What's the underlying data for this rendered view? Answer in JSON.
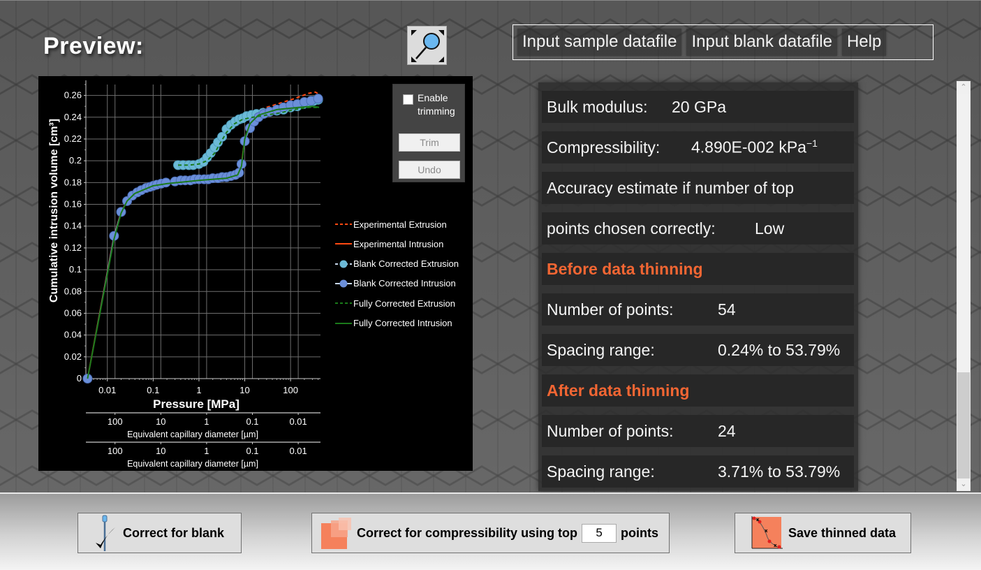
{
  "header": {
    "title": "Preview:",
    "zoom_button_icon": "zoom-magnifier-icon"
  },
  "menu": {
    "items": [
      {
        "label": "Input sample datafile"
      },
      {
        "label": "Input blank datafile"
      },
      {
        "label": "Help"
      }
    ]
  },
  "trim_panel": {
    "checkbox_label": "Enable trimming",
    "checked": false,
    "trim_label": "Trim",
    "undo_label": "Undo"
  },
  "results": {
    "bulk_modulus_label": "Bulk modulus:",
    "bulk_modulus_value": "20 GPa",
    "compressibility_label": "Compressibility:",
    "compressibility_value": "4.890E-002 kPa",
    "compressibility_unit_exp": "−1",
    "accuracy_line1": "Accuracy estimate if number of top",
    "accuracy_line2_label": "points chosen correctly:",
    "accuracy_value": "Low",
    "before_heading": "Before data thinning",
    "before_points_label": "Number of points:",
    "before_points_value": "54",
    "before_spacing_label": "Spacing range:",
    "before_spacing_value": "0.24% to 53.79%",
    "after_heading": "After data thinning",
    "after_points_label": "Number of points:",
    "after_points_value": "24",
    "after_spacing_label": "Spacing range:",
    "after_spacing_value": "3.71% to 53.79%"
  },
  "actions": {
    "correct_blank_label": "Correct for blank",
    "correct_compress_label": "Correct for compressibility using top",
    "top_points_value": "5",
    "points_suffix": "points",
    "save_label": "Save thinned data"
  },
  "colors": {
    "accent_orange": "#f26633",
    "exp_line": "#ff4a12",
    "blank_extrusion": "#6cb9d6",
    "blank_intrusion": "#6b8fd9",
    "fully_corrected": "#1a7a1a"
  },
  "chart_data": {
    "type": "scatter",
    "xlabel": "Pressure [MPa]",
    "ylabel": "Cumulative intrusion volume [cm³]",
    "xscale": "log",
    "xlim": [
      0.0034,
      450
    ],
    "ylim": [
      0,
      0.27
    ],
    "x_ticks": [
      "0.01",
      "0.1",
      "1",
      "10",
      "100"
    ],
    "x_tick_values": [
      0.01,
      0.1,
      1,
      10,
      100
    ],
    "y_ticks": [
      "0",
      "0.02",
      "0.04",
      "0.06",
      "0.08",
      "0.1",
      "0.12",
      "0.14",
      "0.16",
      "0.18",
      "0.2",
      "0.22",
      "0.24",
      "0.26"
    ],
    "y_tick_values": [
      0,
      0.02,
      0.04,
      0.06,
      0.08,
      0.1,
      0.12,
      0.14,
      0.16,
      0.18,
      0.2,
      0.22,
      0.24,
      0.26
    ],
    "grid": true,
    "legend_position": "right",
    "secondary_axes": [
      {
        "label": "Equivalent capillary diameter [µm]",
        "ticks": [
          "100",
          "10",
          "1",
          "0.1",
          "0.01"
        ],
        "tick_pressure": [
          0.0147,
          0.147,
          1.47,
          14.7,
          147
        ]
      },
      {
        "label": "Equivalent capillary diameter [µm]",
        "ticks": [
          "100",
          "10",
          "1",
          "0.1",
          "0.01"
        ],
        "tick_pressure": [
          0.0147,
          0.147,
          1.47,
          14.7,
          147
        ]
      }
    ],
    "series": [
      {
        "name": "Experimental Extrusion",
        "style": "dashed",
        "color": "#ff4a12",
        "x": [
          0.35,
          0.6,
          1.0,
          1.5,
          2.2,
          3.0,
          4.0,
          6.0,
          9.0,
          15,
          30,
          60,
          120,
          250,
          350,
          420
        ],
        "y": [
          0.196,
          0.196,
          0.197,
          0.2,
          0.208,
          0.218,
          0.228,
          0.236,
          0.241,
          0.245,
          0.249,
          0.253,
          0.257,
          0.262,
          0.263,
          0.261
        ]
      },
      {
        "name": "Experimental Intrusion",
        "style": "solid",
        "color": "#ff4a12",
        "x": [
          0.0037,
          0.014,
          0.02,
          0.027,
          0.04,
          0.1,
          0.2,
          1,
          4,
          7,
          8.5,
          10,
          13,
          20,
          50,
          150,
          420
        ],
        "y": [
          0.0,
          0.131,
          0.153,
          0.163,
          0.17,
          0.177,
          0.18,
          0.183,
          0.185,
          0.189,
          0.197,
          0.22,
          0.232,
          0.24,
          0.246,
          0.25,
          0.257
        ]
      },
      {
        "name": "Blank Corrected Extrusion",
        "style": "dashed-marker",
        "color": "#6cb9d6",
        "x": [
          0.35,
          0.45,
          0.6,
          0.75,
          1.0,
          1.25,
          1.5,
          1.8,
          2.2,
          2.6,
          3.2,
          4.0,
          5.0,
          6.2,
          7.5,
          9.0,
          11,
          14,
          18,
          25,
          35,
          50,
          70,
          100,
          140,
          190,
          250,
          320,
          400
        ],
        "y": [
          0.196,
          0.196,
          0.196,
          0.196,
          0.197,
          0.199,
          0.203,
          0.207,
          0.212,
          0.217,
          0.222,
          0.229,
          0.233,
          0.236,
          0.238,
          0.239,
          0.241,
          0.242,
          0.243,
          0.244,
          0.245,
          0.246,
          0.247,
          0.249,
          0.25,
          0.252,
          0.253,
          0.255,
          0.256
        ]
      },
      {
        "name": "Blank Corrected Intrusion",
        "style": "solid-marker",
        "color": "#6b8fd9",
        "x": [
          0.0037,
          0.014,
          0.02,
          0.027,
          0.035,
          0.045,
          0.055,
          0.07,
          0.085,
          0.1,
          0.12,
          0.15,
          0.19,
          0.3,
          0.4,
          0.5,
          0.65,
          0.8,
          1.0,
          1.3,
          1.6,
          2.0,
          2.6,
          3.2,
          4.0,
          5.0,
          6.2,
          7.5,
          8.5,
          10,
          13,
          16,
          20,
          26,
          35,
          50,
          70,
          100,
          140,
          200,
          280,
          400
        ],
        "y": [
          0.0,
          0.131,
          0.153,
          0.163,
          0.168,
          0.171,
          0.173,
          0.175,
          0.176,
          0.177,
          0.178,
          0.179,
          0.18,
          0.181,
          0.182,
          0.182,
          0.182,
          0.183,
          0.183,
          0.183,
          0.183,
          0.184,
          0.184,
          0.185,
          0.185,
          0.186,
          0.187,
          0.189,
          0.197,
          0.218,
          0.23,
          0.236,
          0.24,
          0.243,
          0.245,
          0.247,
          0.249,
          0.251,
          0.252,
          0.254,
          0.255,
          0.257
        ]
      },
      {
        "name": "Fully Corrected Extrusion",
        "style": "dashed",
        "color": "#1a7a1a",
        "x": [
          0.35,
          0.6,
          1.0,
          1.5,
          2.2,
          3.0,
          4.0,
          6.0,
          9.0,
          15,
          30,
          60,
          120,
          250,
          400
        ],
        "y": [
          0.196,
          0.196,
          0.197,
          0.2,
          0.207,
          0.217,
          0.226,
          0.234,
          0.238,
          0.24,
          0.242,
          0.244,
          0.247,
          0.249,
          0.249
        ]
      },
      {
        "name": "Fully Corrected Intrusion",
        "style": "solid",
        "color": "#1a7a1a",
        "x": [
          0.0037,
          0.014,
          0.02,
          0.027,
          0.04,
          0.1,
          0.2,
          1,
          4,
          7,
          8.5,
          10,
          13,
          20,
          50,
          150,
          300,
          420
        ],
        "y": [
          0.0,
          0.128,
          0.152,
          0.163,
          0.17,
          0.177,
          0.179,
          0.182,
          0.184,
          0.187,
          0.195,
          0.22,
          0.234,
          0.242,
          0.247,
          0.249,
          0.25,
          0.249
        ]
      }
    ]
  }
}
